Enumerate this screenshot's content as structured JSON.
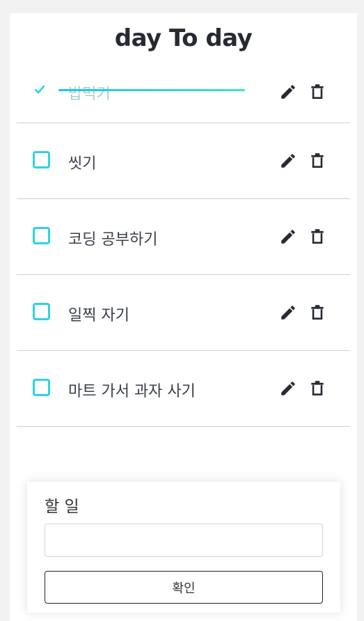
{
  "app": {
    "title": "day To day"
  },
  "todos": [
    {
      "text": "밥먹기",
      "done": true
    },
    {
      "text": "씻기",
      "done": false
    },
    {
      "text": "코딩 공부하기",
      "done": false
    },
    {
      "text": "일찍 자기",
      "done": false
    },
    {
      "text": "마트 가서 과자 사기",
      "done": false
    }
  ],
  "form": {
    "label": "할 일",
    "input_value": "",
    "input_placeholder": "",
    "submit_label": "확인"
  },
  "colors": {
    "accent": "#2ed3e0",
    "strike_start": "#1ec4ec",
    "strike_end": "#33e8c8",
    "done_text": "#a6cfd0",
    "icon": "#262a33"
  },
  "icons": {
    "edit": "pencil-icon",
    "delete": "trash-icon",
    "done": "checkmark-icon"
  }
}
